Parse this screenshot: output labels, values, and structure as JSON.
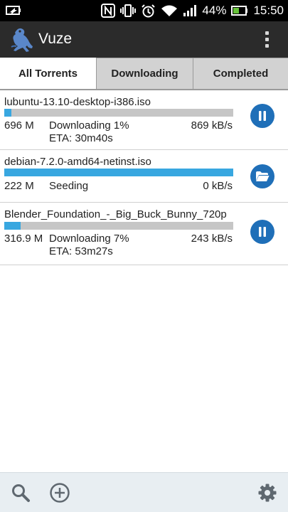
{
  "status_bar": {
    "battery_percent": "44%",
    "time": "15:50",
    "icons": [
      "battery-saver-icon",
      "nfc-icon",
      "vibrate-icon",
      "alarm-icon",
      "wifi-icon",
      "signal-icon",
      "battery-icon"
    ]
  },
  "app": {
    "title": "Vuze",
    "logo_icon": "vuze-frog-logo",
    "menu_icon": "overflow-menu-icon"
  },
  "tabs": [
    {
      "label": "All Torrents",
      "active": true
    },
    {
      "label": "Downloading",
      "active": false
    },
    {
      "label": "Completed",
      "active": false
    }
  ],
  "torrents": [
    {
      "name": "lubuntu-13.10-desktop-i386.iso",
      "size": "696 M",
      "status": "Downloading 1%",
      "eta": "ETA: 30m40s",
      "rate": "869 kB/s",
      "progress": 0.01,
      "action_icon": "pause-icon"
    },
    {
      "name": "debian-7.2.0-amd64-netinst.iso",
      "size": "222 M",
      "status": "Seeding",
      "eta": "",
      "rate": "0 kB/s",
      "progress": 1.0,
      "action_icon": "folder-icon"
    },
    {
      "name": "Blender_Foundation_-_Big_Buck_Bunny_720p",
      "size": "316.9 M",
      "status": "Downloading 7%",
      "eta": "ETA: 53m27s",
      "rate": "243 kB/s",
      "progress": 0.07,
      "action_icon": "pause-icon"
    }
  ],
  "bottom_bar": {
    "icons": [
      "search-icon",
      "add-icon",
      "settings-icon"
    ]
  },
  "colors": {
    "status_bar": "#000000",
    "app_bar": "#2b2b2b",
    "tab_bg": "#d2d2d2",
    "progress_fill": "#38a7e0",
    "progress_track": "#c6c6c6",
    "action_button": "#1f6fb8",
    "bottom_bar": "#e8eef2"
  }
}
